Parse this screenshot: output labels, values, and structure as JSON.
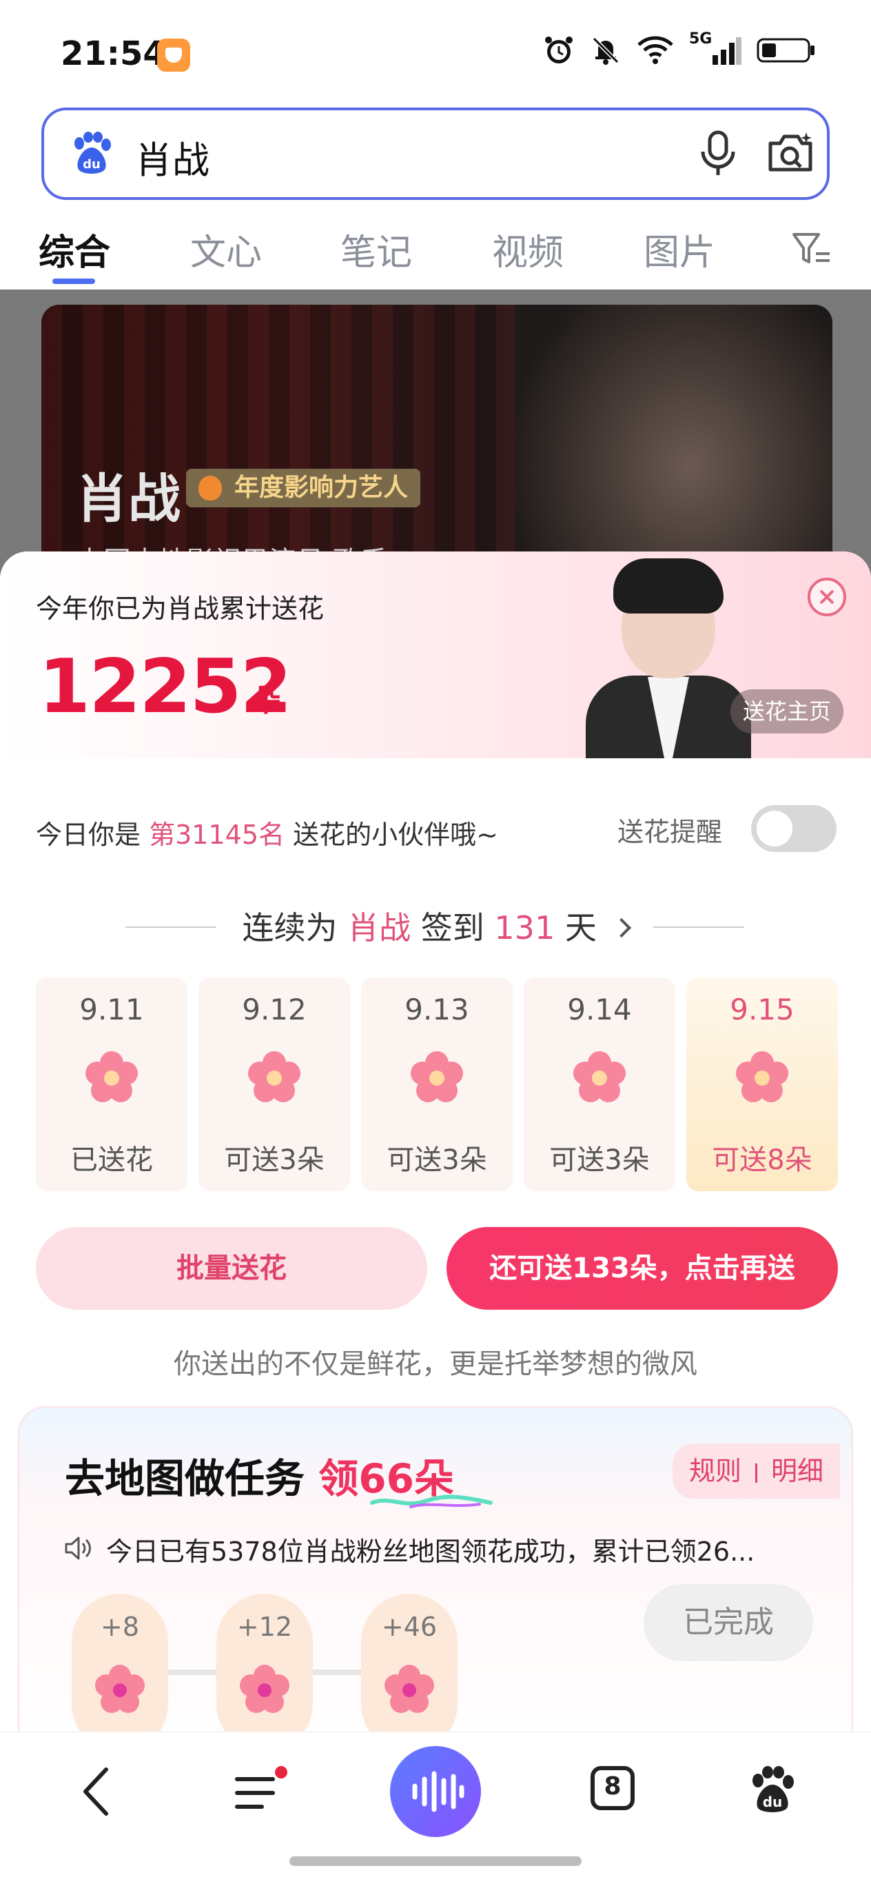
{
  "status_bar": {
    "time": "21:54",
    "network_label": "5G",
    "icons": [
      "alarm-icon",
      "mute-bell-icon",
      "wifi-icon",
      "signal-icon",
      "battery-icon"
    ]
  },
  "search": {
    "query": "肖战",
    "icons": [
      "baidu-logo-icon",
      "mic-icon",
      "camera-search-icon"
    ]
  },
  "tabs": [
    {
      "label": "综合",
      "active": true
    },
    {
      "label": "文心",
      "active": false
    },
    {
      "label": "笔记",
      "active": false
    },
    {
      "label": "视频",
      "active": false
    },
    {
      "label": "图片",
      "active": false
    }
  ],
  "hero": {
    "name": "肖战",
    "tag": "年度影响力艺人",
    "subtitle": "中国内地影视男演员 歌手"
  },
  "panel": {
    "total_label": "今年你已为肖战累计送花",
    "total_count": "12252",
    "total_unit": "朵",
    "home_button": "送花主页",
    "rank_prefix": "今日你是",
    "rank_value": "第31145名",
    "rank_suffix": "送花的小伙伴哦~",
    "reminder_label": "送花提醒",
    "reminder_on": false,
    "streak_prefix": "连续为",
    "streak_name": "肖战",
    "streak_mid": "签到",
    "streak_days": "131",
    "streak_suffix": "天",
    "days": [
      {
        "date": "9.11",
        "status": "已送花",
        "today": false
      },
      {
        "date": "9.12",
        "status": "可送3朵",
        "today": false
      },
      {
        "date": "9.13",
        "status": "可送3朵",
        "today": false
      },
      {
        "date": "9.14",
        "status": "可送3朵",
        "today": false
      },
      {
        "date": "9.15",
        "status": "可送8朵",
        "today": true
      }
    ],
    "batch_button": "批量送花",
    "send_button": "还可送133朵，点击再送",
    "slogan": "你送出的不仅是鲜花，更是托举梦想的微风"
  },
  "task": {
    "title": "去地图做任务",
    "reward": "领66朵",
    "rules_label": "规则",
    "details_label": "明细",
    "notice": "今日已有5378位肖战粉丝地图领花成功，累计已领26...",
    "nodes": [
      "+8",
      "+12",
      "+46"
    ],
    "done_label": "已完成"
  },
  "bottom_nav": {
    "tabs_count": "8",
    "icons": [
      "back-arrow-icon",
      "menu-icon",
      "voice-assistant-icon",
      "tabs-icon",
      "baidu-paw-icon"
    ]
  },
  "colors": {
    "accent": "#e5173f",
    "pink": "#e0527a",
    "search_border": "#5a6ae6",
    "tab_underline": "#4e6ef2"
  }
}
